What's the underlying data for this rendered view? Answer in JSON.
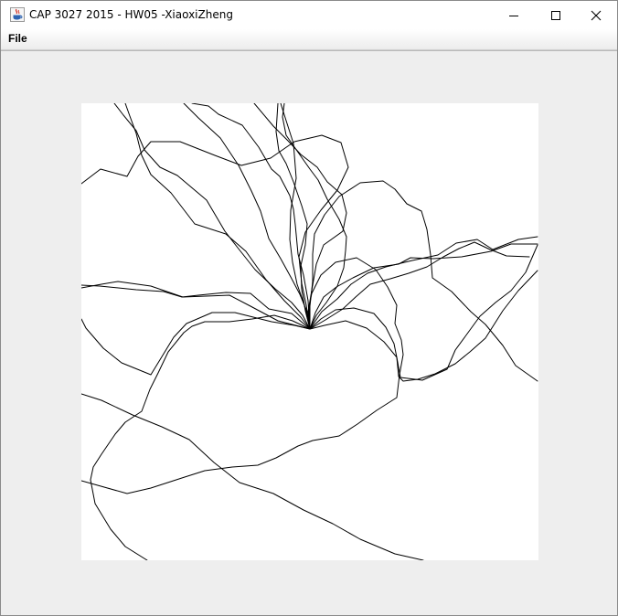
{
  "window": {
    "title": "CAP 3027 2015 - HW05 -XiaoxiZheng",
    "icon": "java-cup-icon",
    "controls": [
      "minimize-icon",
      "maximize-icon",
      "close-icon"
    ]
  },
  "menubar": {
    "items": [
      {
        "label": "File"
      }
    ]
  },
  "canvas": {
    "background": "#ffffff",
    "stroke": "#000000"
  }
}
